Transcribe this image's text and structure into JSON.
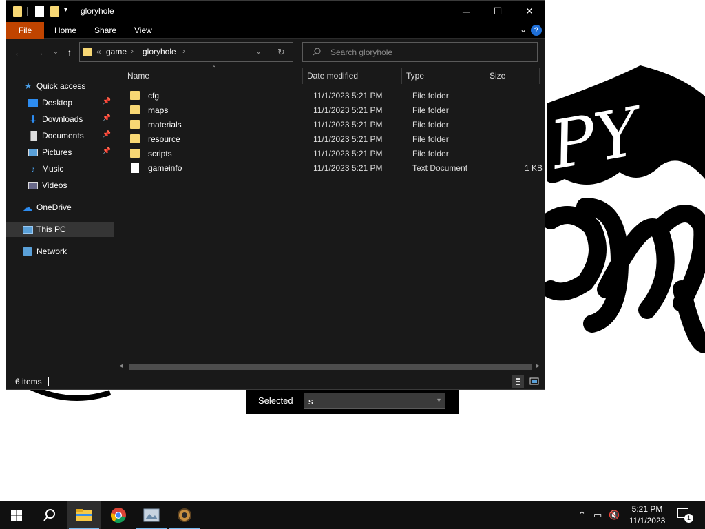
{
  "window": {
    "title": "gloryhole",
    "controls": {
      "minimize": "─",
      "maximize": "☐",
      "close": "✕"
    }
  },
  "ribbon": {
    "tabs": [
      "File",
      "Home",
      "Share",
      "View"
    ],
    "help": "?"
  },
  "address": {
    "overflow": "«",
    "crumbs": [
      "game",
      "gloryhole"
    ],
    "search_placeholder": "Search gloryhole"
  },
  "sidebar": {
    "items": [
      {
        "label": "Quick access",
        "icon": "star-icon",
        "pinned": false
      },
      {
        "label": "Desktop",
        "icon": "desktop-icon",
        "pinned": true
      },
      {
        "label": "Downloads",
        "icon": "download-icon",
        "pinned": true
      },
      {
        "label": "Documents",
        "icon": "documents-icon",
        "pinned": true
      },
      {
        "label": "Pictures",
        "icon": "pictures-icon",
        "pinned": true
      },
      {
        "label": "Music",
        "icon": "music-icon",
        "pinned": false
      },
      {
        "label": "Videos",
        "icon": "videos-icon",
        "pinned": false
      },
      {
        "label": "OneDrive",
        "icon": "cloud-icon",
        "pinned": false
      },
      {
        "label": "This PC",
        "icon": "computer-icon",
        "pinned": false,
        "selected": true
      },
      {
        "label": "Network",
        "icon": "network-icon",
        "pinned": false
      }
    ]
  },
  "columns": {
    "name": "Name",
    "date": "Date modified",
    "type": "Type",
    "size": "Size"
  },
  "files": [
    {
      "name": "cfg",
      "date": "11/1/2023 5:21 PM",
      "type": "File folder",
      "size": "",
      "kind": "folder"
    },
    {
      "name": "maps",
      "date": "11/1/2023 5:21 PM",
      "type": "File folder",
      "size": "",
      "kind": "folder"
    },
    {
      "name": "materials",
      "date": "11/1/2023 5:21 PM",
      "type": "File folder",
      "size": "",
      "kind": "folder"
    },
    {
      "name": "resource",
      "date": "11/1/2023 5:21 PM",
      "type": "File folder",
      "size": "",
      "kind": "folder"
    },
    {
      "name": "scripts",
      "date": "11/1/2023 5:21 PM",
      "type": "File folder",
      "size": "",
      "kind": "folder"
    },
    {
      "name": "gameinfo",
      "date": "11/1/2023 5:21 PM",
      "type": "Text Document",
      "size": "1 KB",
      "kind": "document"
    }
  ],
  "status": {
    "count": "6 items"
  },
  "selected_panel": {
    "label": "Selected",
    "value": "s"
  },
  "taskbar": {
    "apps": [
      "start-icon",
      "search-icon",
      "file-explorer-icon",
      "chrome-icon",
      "image-viewer-icon",
      "gear-app-icon"
    ],
    "time": "5:21 PM",
    "date": "11/1/2023",
    "notification_count": "1"
  },
  "wallpaper": {
    "text": "PY",
    "color": "#000000"
  },
  "colors": {
    "accent": "#c04400",
    "folder": "#f7d774",
    "selection": "#353535"
  }
}
